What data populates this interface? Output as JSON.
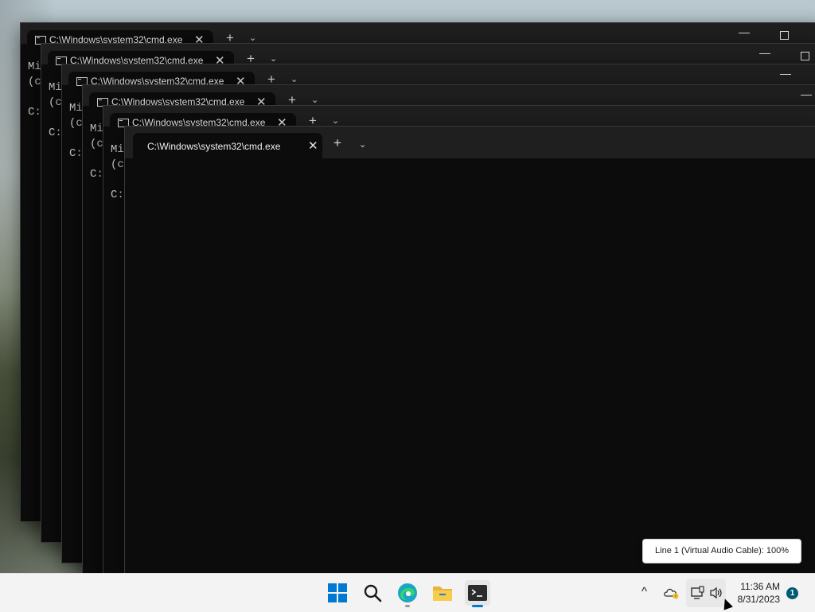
{
  "windows": [
    {
      "tab_title": "C:\\Windows\\system32\\cmd.exe",
      "console_lines": [
        "Mi",
        "(c",
        "",
        "C:"
      ]
    },
    {
      "tab_title": "C:\\Windows\\system32\\cmd.exe",
      "console_lines": [
        "Mi",
        "(c",
        "",
        "C:"
      ]
    },
    {
      "tab_title": "C:\\Windows\\system32\\cmd.exe",
      "console_lines": [
        "Mi",
        "(c",
        "",
        "C:"
      ]
    },
    {
      "tab_title": "C:\\Windows\\system32\\cmd.exe",
      "console_lines": [
        "Mi",
        "(c",
        "",
        "C:"
      ]
    },
    {
      "tab_title": "C:\\Windows\\system32\\cmd.exe",
      "console_lines": [
        "Mi",
        "(c",
        "",
        "C:"
      ]
    }
  ],
  "active_window": {
    "tab_title": "C:\\Windows\\system32\\cmd.exe",
    "close_glyph": "✕",
    "newtab_glyph": "+",
    "dropdown_glyph": "⌄"
  },
  "glyphs": {
    "close": "✕",
    "newtab": "+",
    "dropdown": "⌄",
    "minimize": "—"
  },
  "tooltip": {
    "text": "Line 1 (Virtual Audio Cable): 100%"
  },
  "taskbar": {
    "items": [
      {
        "name": "start-icon"
      },
      {
        "name": "search-icon"
      },
      {
        "name": "edge-icon"
      },
      {
        "name": "file-explorer-icon"
      },
      {
        "name": "terminal-icon"
      }
    ],
    "tray": {
      "chevron": "^"
    },
    "clock": {
      "time": "11:36 AM",
      "date": "8/31/2023"
    },
    "notification_count": "1"
  },
  "colors": {
    "accent": "#0078d4",
    "terminal_bg": "#0c0c0c",
    "taskbar_bg": "#f3f3f3",
    "badge": "#005a73"
  }
}
